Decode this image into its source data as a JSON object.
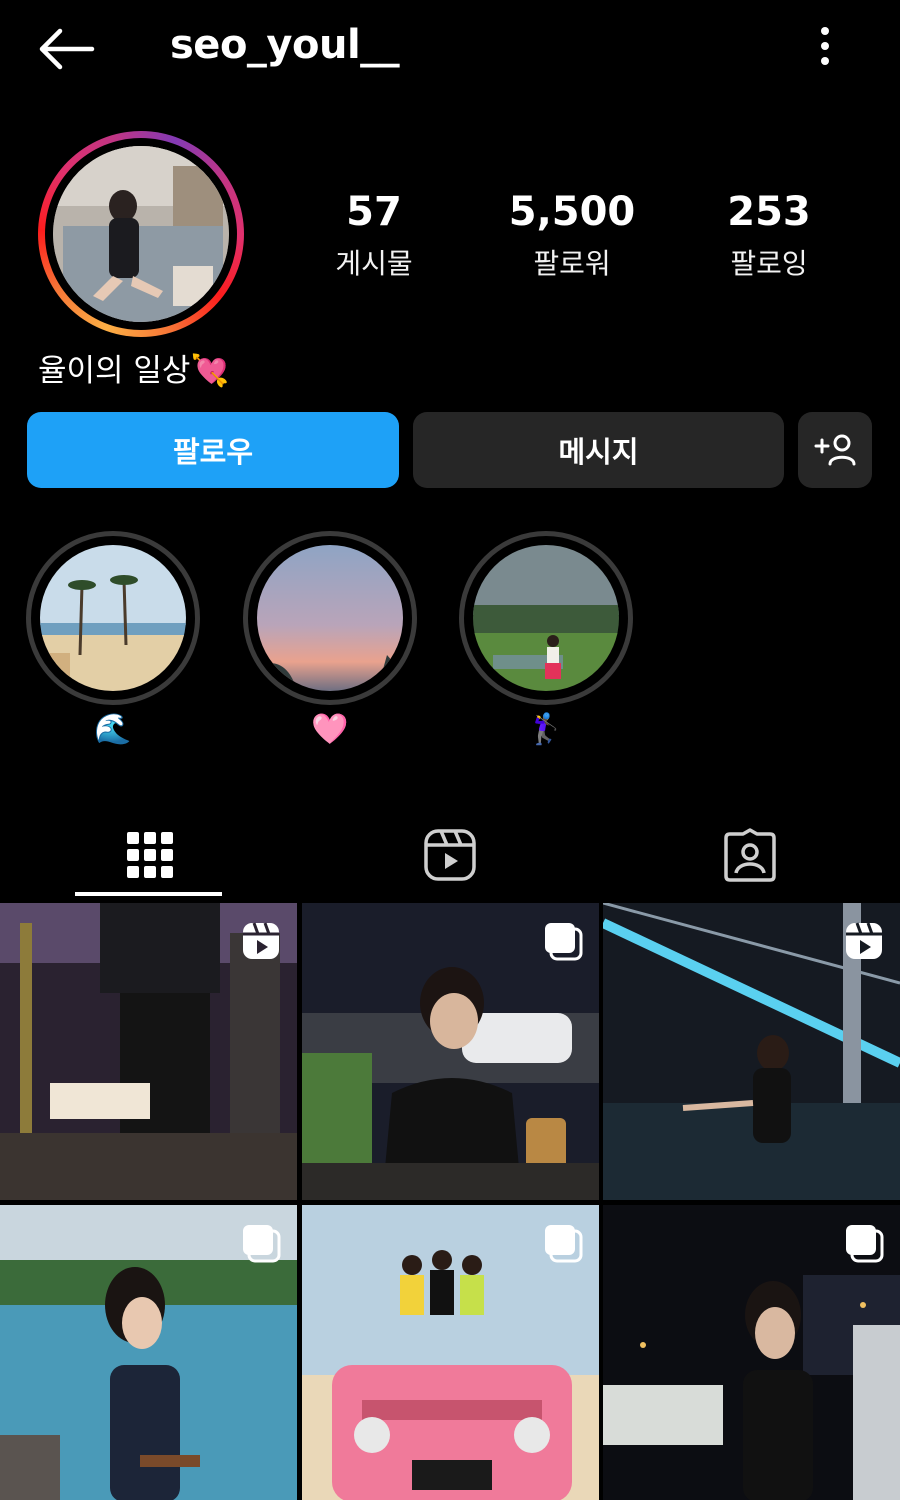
{
  "header": {
    "username": "seo_youl__"
  },
  "stats": {
    "posts_count": "57",
    "posts_label": "게시물",
    "followers_count": "5,500",
    "followers_label": "팔로워",
    "following_count": "253",
    "following_label": "팔로잉"
  },
  "bio": "율이의 일상💘",
  "actions": {
    "follow_label": "팔로우",
    "message_label": "메시지"
  },
  "highlights": [
    {
      "label": "🌊"
    },
    {
      "label": "🩷"
    },
    {
      "label": "🏌️‍♀️"
    }
  ],
  "tabs": [
    "grid-icon",
    "reels-icon",
    "tagged-icon"
  ],
  "colors": {
    "follow_button": "#1ea1f7",
    "secondary_button": "#262626",
    "background": "#000000"
  },
  "grid_posts": [
    {
      "type": "reel"
    },
    {
      "type": "carousel"
    },
    {
      "type": "reel"
    },
    {
      "type": "carousel"
    },
    {
      "type": "carousel"
    },
    {
      "type": "carousel"
    }
  ]
}
